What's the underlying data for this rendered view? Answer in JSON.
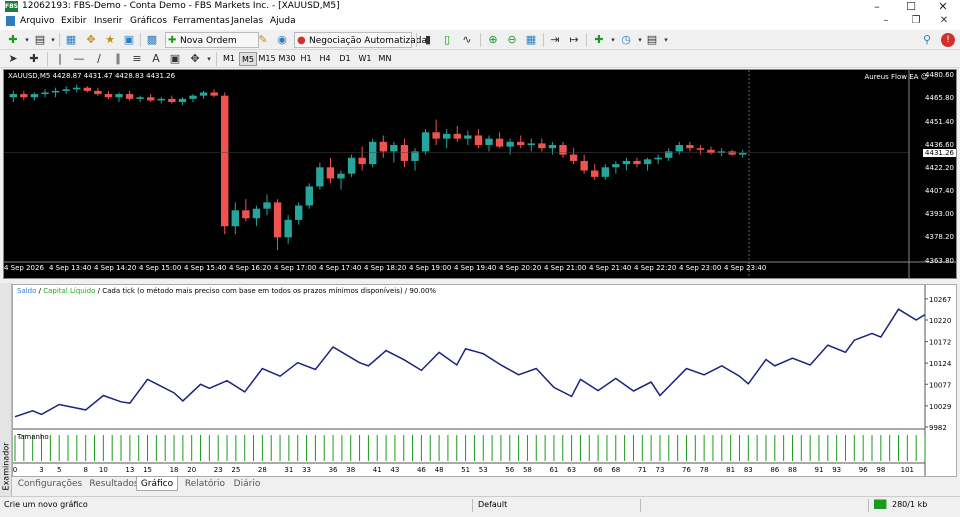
{
  "window": {
    "title": "12062193: FBS-Demo - Conta Demo - FBS Markets Inc. - [XAUUSD,M5]",
    "icon_label": "FBS",
    "controls": [
      "minimize-icon",
      "maximize-icon",
      "close-icon"
    ]
  },
  "menubar": {
    "items": [
      "Arquivo",
      "Exibir",
      "Inserir",
      "Gráficos",
      "Ferramentas",
      "Janelas",
      "Ajuda"
    ],
    "mdi_controls": [
      "minimize-icon",
      "restore-icon",
      "close-icon"
    ]
  },
  "toolbar": {
    "new_order_label": "Nova Ordem",
    "auto_trading_label": "Negociação Automatizada",
    "auto_trading_icon": "stop-icon",
    "notification_icon": "search-icon",
    "alert_badge": "alert-icon"
  },
  "timeframes": {
    "items": [
      "M1",
      "M5",
      "M15",
      "M30",
      "H1",
      "H4",
      "D1",
      "W1",
      "MN"
    ],
    "selected": "M5"
  },
  "drawing_tools": {
    "text_tool_label": "A"
  },
  "chart": {
    "symbol_info": "XAUUSD,M5  4428.87 4431.47 4428.83 4431.26",
    "ea_label": "Aureus Flow EA",
    "ea_icon": "smiley-icon",
    "current_price": "4431.26",
    "price_ticks": [
      "4480.60",
      "4465.80",
      "4451.40",
      "4436.60",
      "4422.20",
      "4407.40",
      "4393.00",
      "4378.20",
      "4363.80"
    ],
    "time_ticks": [
      "4 Sep 2026",
      "4 Sep 13:40",
      "4 Sep 14:20",
      "4 Sep 15:00",
      "4 Sep 15:40",
      "4 Sep 16:20",
      "4 Sep 17:00",
      "4 Sep 17:40",
      "4 Sep 18:20",
      "4 Sep 19:00",
      "4 Sep 19:40",
      "4 Sep 20:20",
      "4 Sep 21:00",
      "4 Sep 21:40",
      "4 Sep 22:20",
      "4 Sep 23:00",
      "4 Sep 23:40"
    ],
    "bull_color": "#26a69a",
    "bear_color": "#ef5350",
    "background": "#000000"
  },
  "tester": {
    "legend_balance": "Saldo",
    "legend_equity": "Capital Líquido",
    "legend_rest": "Cada tick (o método mais preciso com base em todos os prazos mínimos disponíveis) / 90.00%",
    "balance_color": "#3a7bd5",
    "equity_color": "#22aa22",
    "volume_label": "Tamanho",
    "side_label": "Examinador",
    "tabs": [
      "Configurações",
      "Resultados",
      "Gráfico",
      "Relatório",
      "Diário"
    ],
    "active_tab": "Gráfico"
  },
  "chart_data": [
    {
      "type": "line",
      "title": "",
      "xlabel": "",
      "ylabel": "",
      "y_ticks": [
        "10267",
        "10220",
        "10172",
        "10124",
        "10077",
        "10029",
        "9982"
      ],
      "x_ticks": [
        "0",
        "3",
        "5",
        "8",
        "10",
        "13",
        "15",
        "18",
        "20",
        "23",
        "25",
        "28",
        "31",
        "33",
        "36",
        "38",
        "41",
        "43",
        "46",
        "48",
        "51",
        "53",
        "56",
        "58",
        "61",
        "63",
        "66",
        "68",
        "71",
        "73",
        "76",
        "78",
        "81",
        "83",
        "86",
        "88",
        "91",
        "93",
        "96",
        "98",
        "101"
      ],
      "ylim": [
        9982,
        10280
      ],
      "xlim": [
        0,
        103
      ],
      "series": [
        {
          "name": "Saldo",
          "x": [
            0,
            2,
            3,
            5,
            8,
            10,
            12,
            13,
            15,
            18,
            19,
            21,
            22,
            24,
            26,
            28,
            30,
            32,
            34,
            36,
            39,
            40,
            42,
            44,
            46,
            48,
            50,
            51,
            53,
            55,
            57,
            59,
            61,
            63,
            64,
            66,
            68,
            70,
            72,
            73,
            76,
            78,
            80,
            82,
            83,
            85,
            86,
            88,
            90,
            92,
            94,
            95,
            97,
            98,
            100,
            102,
            103
          ],
          "values": [
            10005,
            10018,
            10010,
            10032,
            10020,
            10052,
            10038,
            10035,
            10088,
            10058,
            10040,
            10077,
            10068,
            10085,
            10060,
            10112,
            10095,
            10125,
            10110,
            10160,
            10125,
            10118,
            10152,
            10132,
            10108,
            10148,
            10120,
            10156,
            10145,
            10120,
            10098,
            10112,
            10070,
            10050,
            10088,
            10063,
            10090,
            10062,
            10082,
            10052,
            10112,
            10098,
            10118,
            10095,
            10078,
            10132,
            10118,
            10135,
            10120,
            10164,
            10148,
            10175,
            10190,
            10182,
            10244,
            10220,
            10232
          ]
        },
        {
          "name": "Capital Líquido",
          "x": [
            0,
            103
          ],
          "values": [
            10005,
            10232
          ]
        }
      ],
      "volume": {
        "name": "Tamanho",
        "values": [
          1,
          1,
          1,
          1,
          1,
          1,
          1,
          1,
          1,
          1,
          1,
          1,
          1,
          1,
          1,
          1,
          1,
          1,
          1,
          1,
          1,
          1,
          1,
          1,
          1,
          1,
          1,
          1,
          1,
          1,
          1,
          1,
          1,
          1,
          1,
          1,
          1,
          1,
          1,
          1,
          1,
          1,
          1,
          1,
          1,
          1,
          1,
          1,
          1,
          1,
          1,
          1,
          1,
          1,
          1,
          1,
          1,
          1,
          1,
          1,
          1,
          1,
          1,
          1,
          1,
          1,
          1,
          1,
          1,
          1,
          1,
          1,
          1,
          1,
          1,
          1,
          1,
          1,
          1,
          1,
          1,
          1,
          1,
          1,
          1,
          1,
          1,
          1,
          1,
          1,
          1,
          1,
          1,
          1,
          1,
          1,
          1,
          1,
          1,
          1,
          1,
          1,
          1,
          1
        ]
      }
    },
    {
      "type": "candlestick",
      "title": "",
      "ylim": [
        4363.8,
        4480.6
      ],
      "candles": [
        [
          4466,
          4470,
          4463,
          4468
        ],
        [
          4468,
          4470,
          4464,
          4466
        ],
        [
          4466,
          4469,
          4464,
          4468
        ],
        [
          4468,
          4471,
          4466,
          4469
        ],
        [
          4469,
          4472,
          4466,
          4470
        ],
        [
          4470,
          4473,
          4468,
          4471
        ],
        [
          4471,
          4474,
          4469,
          4472
        ],
        [
          4472,
          4473,
          4469,
          4470
        ],
        [
          4470,
          4472,
          4467,
          4468
        ],
        [
          4468,
          4470,
          4465,
          4466
        ],
        [
          4466,
          4469,
          4463,
          4468
        ],
        [
          4468,
          4470,
          4464,
          4465
        ],
        [
          4465,
          4467,
          4463,
          4466
        ],
        [
          4466,
          4468,
          4463,
          4464
        ],
        [
          4464,
          4466,
          4462,
          4465
        ],
        [
          4465,
          4467,
          4462,
          4463
        ],
        [
          4463,
          4466,
          4461,
          4465
        ],
        [
          4465,
          4468,
          4463,
          4467
        ],
        [
          4467,
          4470,
          4465,
          4469
        ],
        [
          4469,
          4471,
          4466,
          4467
        ],
        [
          4467,
          4469,
          4380,
          4385
        ],
        [
          4385,
          4400,
          4380,
          4395
        ],
        [
          4395,
          4402,
          4388,
          4390
        ],
        [
          4390,
          4398,
          4385,
          4396
        ],
        [
          4396,
          4405,
          4392,
          4400
        ],
        [
          4400,
          4402,
          4370,
          4378
        ],
        [
          4378,
          4392,
          4374,
          4389
        ],
        [
          4389,
          4400,
          4386,
          4398
        ],
        [
          4398,
          4412,
          4396,
          4410
        ],
        [
          4410,
          4425,
          4408,
          4422
        ],
        [
          4422,
          4428,
          4412,
          4415
        ],
        [
          4415,
          4420,
          4408,
          4418
        ],
        [
          4418,
          4430,
          4416,
          4428
        ],
        [
          4428,
          4435,
          4420,
          4424
        ],
        [
          4424,
          4440,
          4422,
          4438
        ],
        [
          4438,
          4442,
          4428,
          4432
        ],
        [
          4432,
          4438,
          4425,
          4436
        ],
        [
          4436,
          4440,
          4422,
          4426
        ],
        [
          4426,
          4434,
          4420,
          4432
        ],
        [
          4432,
          4446,
          4430,
          4444
        ],
        [
          4444,
          4452,
          4436,
          4440
        ],
        [
          4440,
          4446,
          4434,
          4443
        ],
        [
          4443,
          4448,
          4438,
          4440
        ],
        [
          4440,
          4445,
          4436,
          4442
        ],
        [
          4442,
          4446,
          4434,
          4436
        ],
        [
          4436,
          4442,
          4432,
          4440
        ],
        [
          4440,
          4444,
          4434,
          4435
        ],
        [
          4435,
          4440,
          4430,
          4438
        ],
        [
          4438,
          4442,
          4434,
          4436
        ],
        [
          4436,
          4440,
          4432,
          4437
        ],
        [
          4437,
          4440,
          4432,
          4434
        ],
        [
          4434,
          4438,
          4430,
          4436
        ],
        [
          4436,
          4438,
          4428,
          4430
        ],
        [
          4430,
          4434,
          4424,
          4426
        ],
        [
          4426,
          4430,
          4418,
          4420
        ],
        [
          4420,
          4424,
          4414,
          4416
        ],
        [
          4416,
          4424,
          4414,
          4422
        ],
        [
          4422,
          4426,
          4418,
          4424
        ],
        [
          4424,
          4428,
          4420,
          4426
        ],
        [
          4426,
          4428,
          4422,
          4424
        ],
        [
          4424,
          4428,
          4420,
          4427
        ],
        [
          4427,
          4430,
          4424,
          4428
        ],
        [
          4428,
          4434,
          4426,
          4432
        ],
        [
          4432,
          4438,
          4430,
          4436
        ],
        [
          4436,
          4438,
          4432,
          4434
        ],
        [
          4434,
          4436,
          4430,
          4433
        ],
        [
          4433,
          4435,
          4430,
          4431
        ],
        [
          4431,
          4434,
          4429,
          4432
        ],
        [
          4432,
          4433,
          4429,
          4430
        ],
        [
          4430,
          4433,
          4428,
          4431
        ]
      ]
    }
  ],
  "status": {
    "hint": "Crie um novo gráfico",
    "profile": "Default",
    "traffic": "280/1 kb",
    "traffic_icon": "bars-icon"
  }
}
